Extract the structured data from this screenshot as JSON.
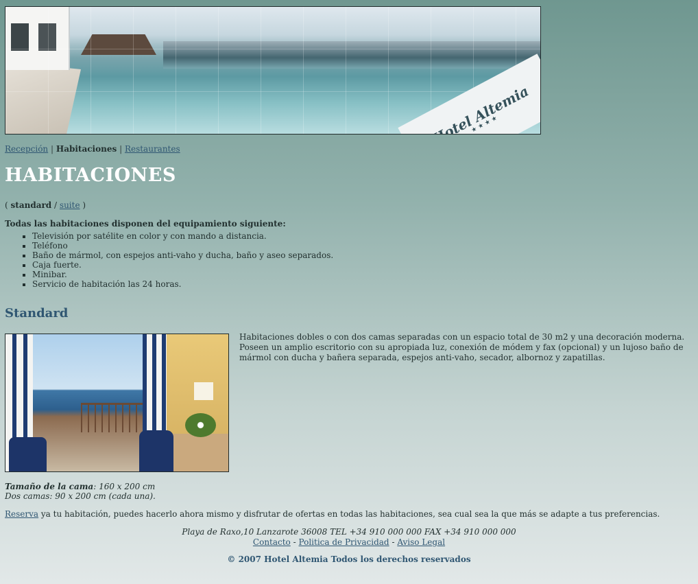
{
  "banner": {
    "logo_text": "Hotel Altemia",
    "logo_stars": "★★★★"
  },
  "nav": {
    "items": [
      {
        "label": "Recepción",
        "current": false
      },
      {
        "label": "Habitaciones",
        "current": true
      },
      {
        "label": "Restaurantes",
        "current": false
      }
    ],
    "separator": "|"
  },
  "page": {
    "title": "HABITACIONES"
  },
  "subnav": {
    "open": "(",
    "current": "standard",
    "separator": "/",
    "link": "suite",
    "close": ")"
  },
  "equipment": {
    "intro": "Todas las habitaciones disponen del equipamiento siguiente:",
    "items": [
      "Televisión por satélite en color y con mando a distancia.",
      "Teléfono",
      "Baño de mármol, con espejos anti-vaho y ducha, baño y aseo separados.",
      "Caja fuerte.",
      "Minibar.",
      "Servicio de habitación las 24 horas."
    ]
  },
  "standard": {
    "heading": "Standard",
    "description": "Habitaciones dobles o con dos camas separadas con un espacio total de 30 m2 y una decoración moderna. Poseen un amplio escritorio con su apropiada luz, conexión de módem y fax (opcional) y un lujoso baño de mármol con ducha y bañera separada, espejos anti-vaho, secador, albornoz y zapatillas.",
    "bed_label": "Tamaño de la cama",
    "bed_size": ": 160 x 200 cm",
    "two_beds": "Dos camas: 90 x 200 cm (cada una)."
  },
  "reserva": {
    "link": "Reserva",
    "text": " ya tu habitación, puedes hacerlo ahora mismo y disfrutar de ofertas en todas las habitaciones, sea cual sea la que más se adapte a tus preferencias."
  },
  "footer": {
    "address": "Playa de Raxo,10 Lanzarote 36008 TEL +34 910 000 000 FAX +34 910 000 000",
    "links": [
      "Contacto",
      "Politica de Privacidad",
      "Aviso Legal"
    ],
    "link_separator": "-",
    "copyright": "© 2007 Hotel Altemia Todos los derechos reservados"
  }
}
